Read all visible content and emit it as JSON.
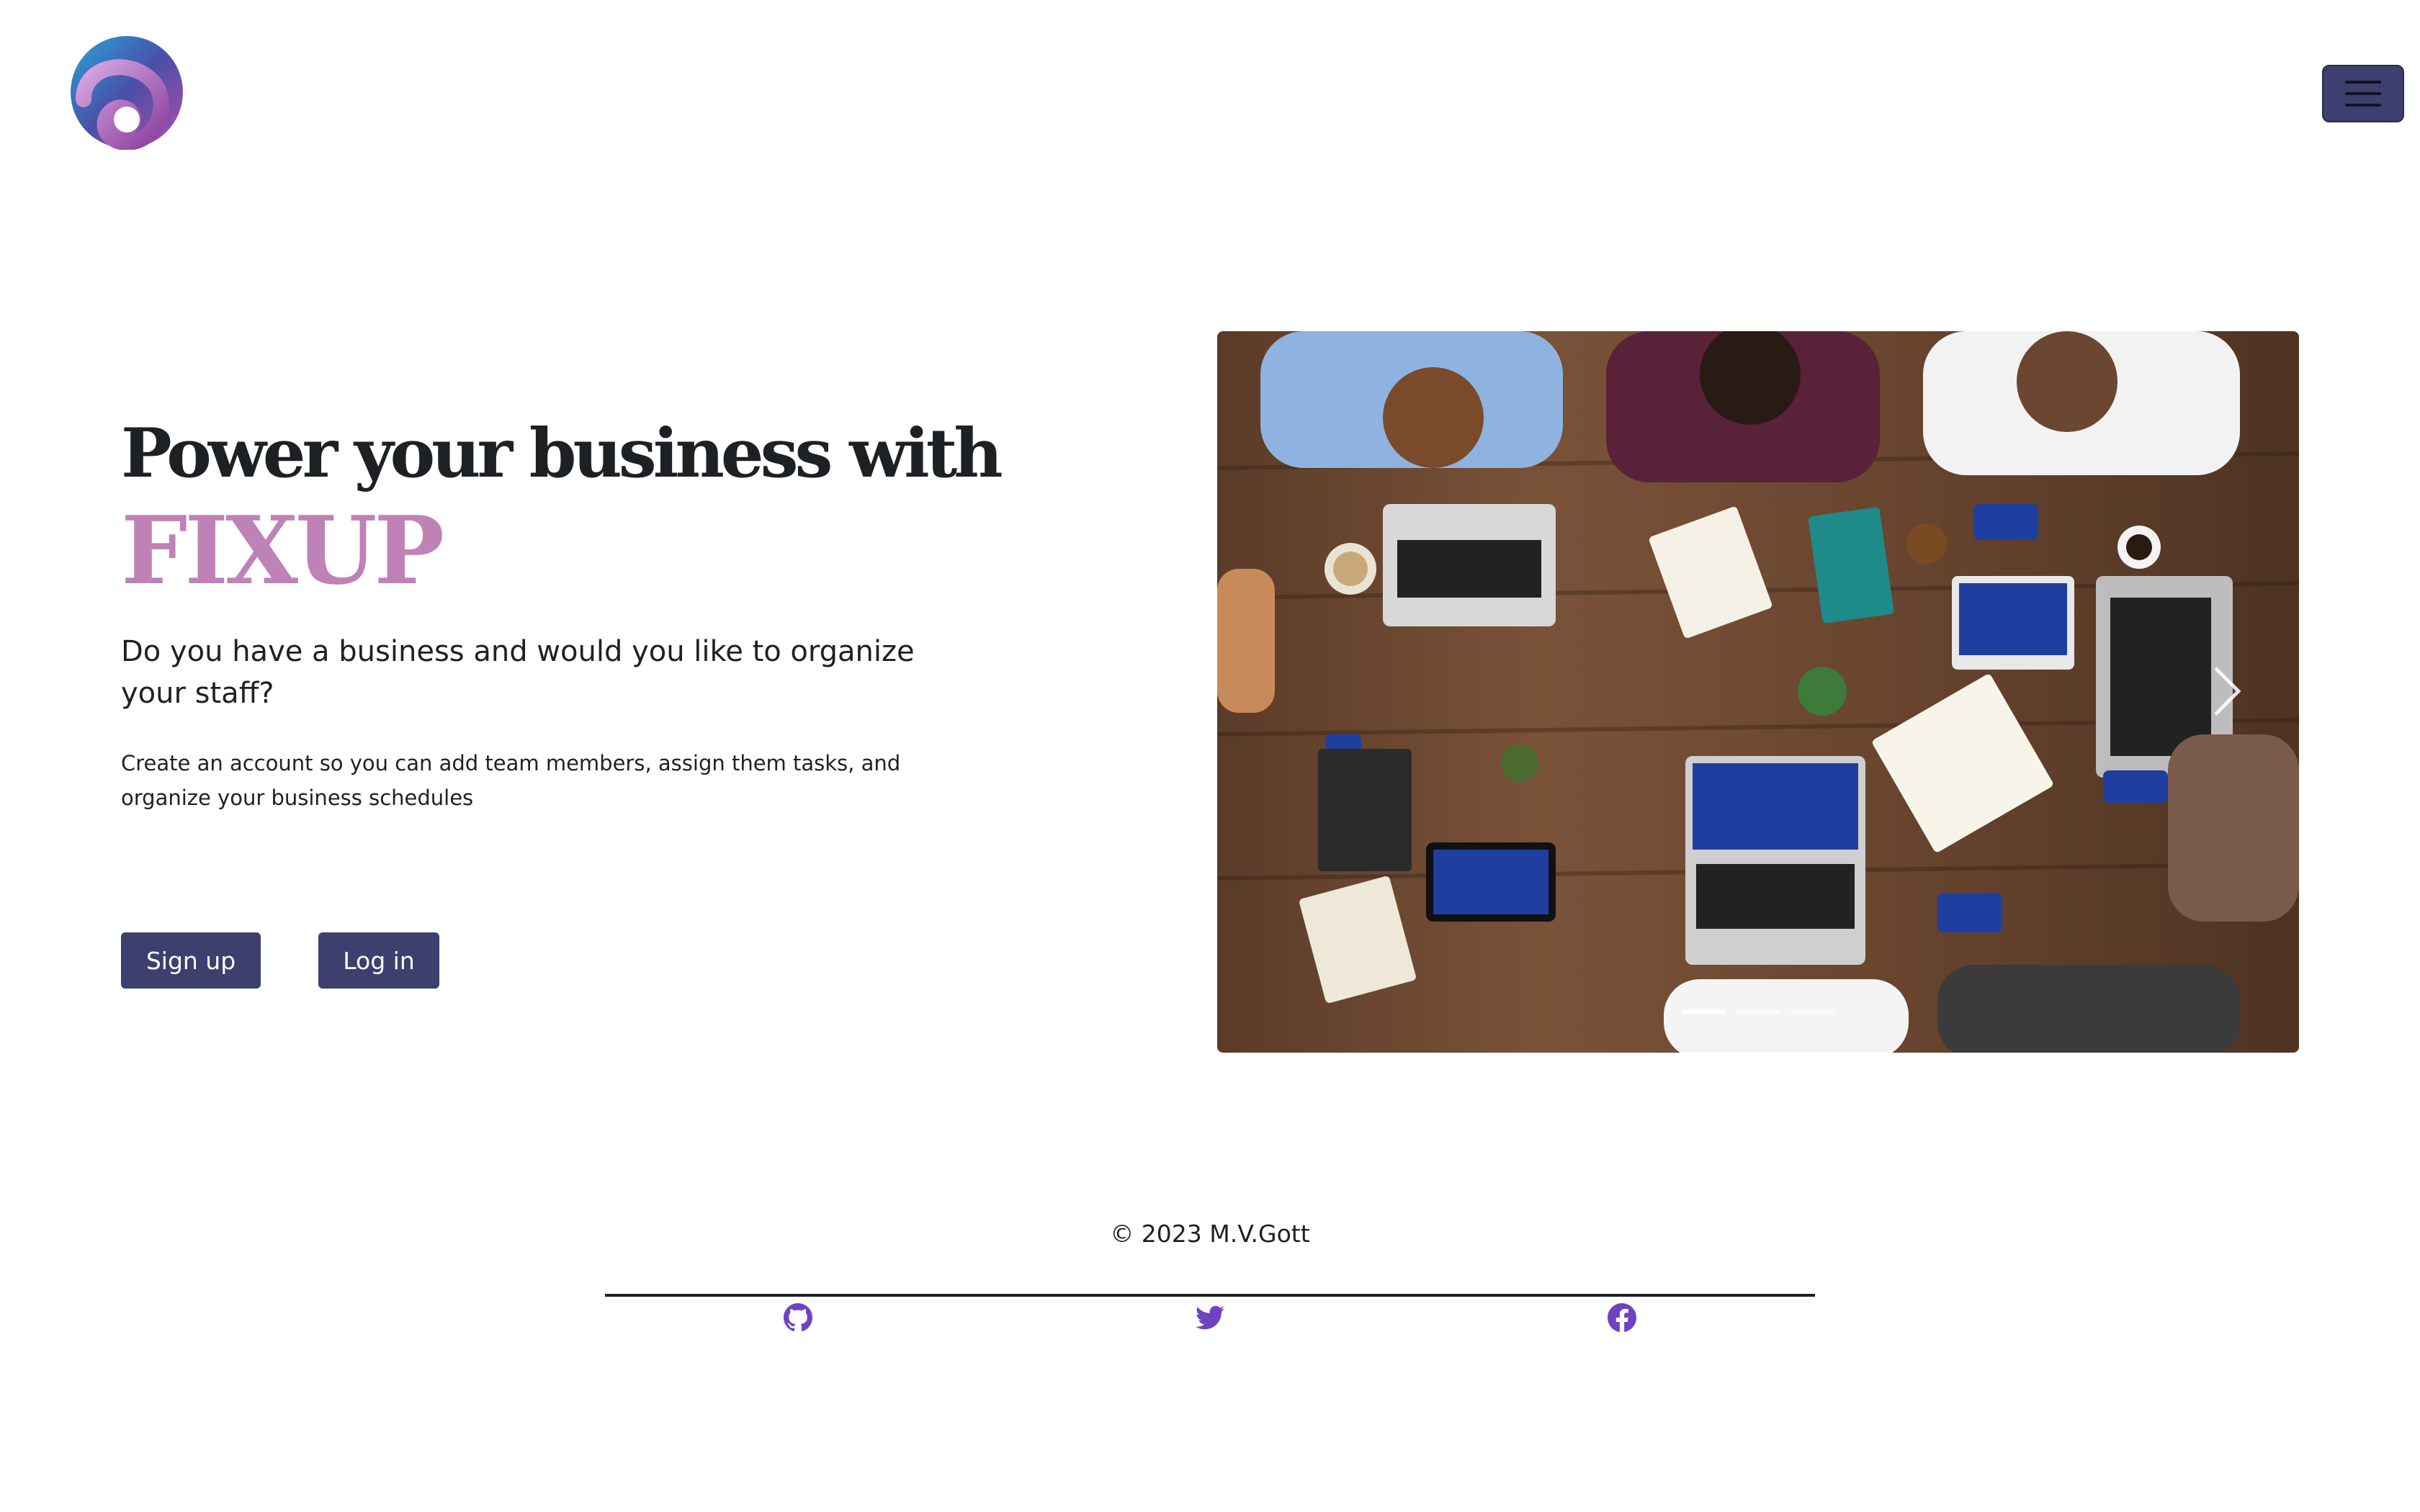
{
  "header": {
    "logo_icon": "fixup-swirl-logo-icon",
    "menu_icon": "hamburger-menu-icon"
  },
  "hero": {
    "title": "Power your business with",
    "brand": "FIXUP",
    "subtitle": "Do you have a business and would you like to organize your staff?",
    "description": "Create an account so you can add team members, assign them tasks, and organize your business schedules",
    "signup_label": "Sign up",
    "login_label": "Log in"
  },
  "carousel": {
    "image_subject": "team meeting around a wooden table with laptops and tablets",
    "next_icon": "chevron-right-icon",
    "slide_count": 3,
    "active_slide": 1
  },
  "footer": {
    "copyright": "© 2023 M.V.Gott",
    "social": [
      "github-icon",
      "twitter-icon",
      "facebook-icon"
    ]
  },
  "colors": {
    "primary": "#3d3f6e",
    "brand_accent": "#bf82b6",
    "social_icon": "#6f42c1",
    "text": "#1e2124"
  }
}
